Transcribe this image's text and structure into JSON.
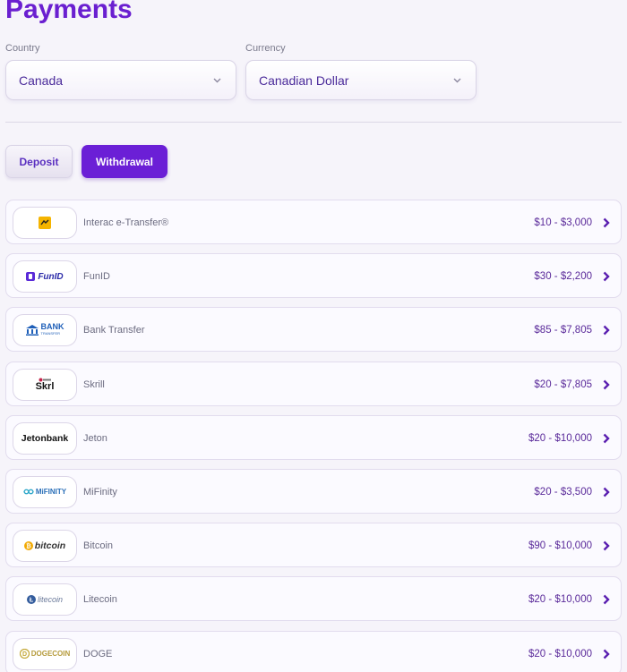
{
  "page": {
    "title": "Payments"
  },
  "country": {
    "label": "Country",
    "value": "Canada"
  },
  "currency": {
    "label": "Currency",
    "value": "Canadian Dollar"
  },
  "tabs": {
    "deposit": "Deposit",
    "withdrawal": "Withdrawal",
    "active": "withdrawal"
  },
  "colors": {
    "accent": "#6b1fd6",
    "title": "#6a1fd0"
  },
  "methods": [
    {
      "name": "Interac e-Transfer®",
      "range": "$10 - $3,000",
      "icon": "interac-logo",
      "logo_text": ""
    },
    {
      "name": "FunID",
      "range": "$30 - $2,200",
      "icon": "funid-logo",
      "logo_text": "FunID"
    },
    {
      "name": "Bank Transfer",
      "range": "$85 - $7,805",
      "icon": "bank-logo",
      "logo_text": "BANK",
      "logo_subtext": "TRANSFER"
    },
    {
      "name": "Skrill",
      "range": "$20 - $7,805",
      "icon": "skrill-logo",
      "logo_text": "Skrl"
    },
    {
      "name": "Jeton",
      "range": "$20 - $10,000",
      "icon": "jeton-logo",
      "logo_text": "Jetonbank"
    },
    {
      "name": "MiFinity",
      "range": "$20 - $3,500",
      "icon": "mifinity-logo",
      "logo_text": "MiFINITY"
    },
    {
      "name": "Bitcoin",
      "range": "$90 - $10,000",
      "icon": "bitcoin-logo",
      "logo_text": "bitcoin"
    },
    {
      "name": "Litecoin",
      "range": "$20 - $10,000",
      "icon": "litecoin-logo",
      "logo_text": "litecoin"
    },
    {
      "name": "DOGE",
      "range": "$20 - $10,000",
      "icon": "dogecoin-logo",
      "logo_text": "DOGECOIN"
    }
  ]
}
